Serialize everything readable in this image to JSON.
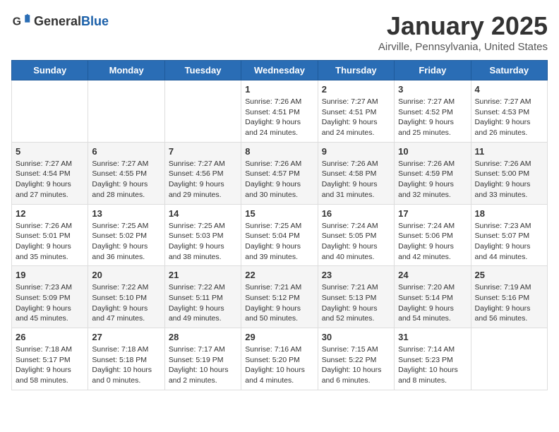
{
  "header": {
    "logo_general": "General",
    "logo_blue": "Blue",
    "month": "January 2025",
    "location": "Airville, Pennsylvania, United States"
  },
  "weekdays": [
    "Sunday",
    "Monday",
    "Tuesday",
    "Wednesday",
    "Thursday",
    "Friday",
    "Saturday"
  ],
  "weeks": [
    [
      {
        "day": "",
        "text": ""
      },
      {
        "day": "",
        "text": ""
      },
      {
        "day": "",
        "text": ""
      },
      {
        "day": "1",
        "text": "Sunrise: 7:26 AM\nSunset: 4:51 PM\nDaylight: 9 hours\nand 24 minutes."
      },
      {
        "day": "2",
        "text": "Sunrise: 7:27 AM\nSunset: 4:51 PM\nDaylight: 9 hours\nand 24 minutes."
      },
      {
        "day": "3",
        "text": "Sunrise: 7:27 AM\nSunset: 4:52 PM\nDaylight: 9 hours\nand 25 minutes."
      },
      {
        "day": "4",
        "text": "Sunrise: 7:27 AM\nSunset: 4:53 PM\nDaylight: 9 hours\nand 26 minutes."
      }
    ],
    [
      {
        "day": "5",
        "text": "Sunrise: 7:27 AM\nSunset: 4:54 PM\nDaylight: 9 hours\nand 27 minutes."
      },
      {
        "day": "6",
        "text": "Sunrise: 7:27 AM\nSunset: 4:55 PM\nDaylight: 9 hours\nand 28 minutes."
      },
      {
        "day": "7",
        "text": "Sunrise: 7:27 AM\nSunset: 4:56 PM\nDaylight: 9 hours\nand 29 minutes."
      },
      {
        "day": "8",
        "text": "Sunrise: 7:26 AM\nSunset: 4:57 PM\nDaylight: 9 hours\nand 30 minutes."
      },
      {
        "day": "9",
        "text": "Sunrise: 7:26 AM\nSunset: 4:58 PM\nDaylight: 9 hours\nand 31 minutes."
      },
      {
        "day": "10",
        "text": "Sunrise: 7:26 AM\nSunset: 4:59 PM\nDaylight: 9 hours\nand 32 minutes."
      },
      {
        "day": "11",
        "text": "Sunrise: 7:26 AM\nSunset: 5:00 PM\nDaylight: 9 hours\nand 33 minutes."
      }
    ],
    [
      {
        "day": "12",
        "text": "Sunrise: 7:26 AM\nSunset: 5:01 PM\nDaylight: 9 hours\nand 35 minutes."
      },
      {
        "day": "13",
        "text": "Sunrise: 7:25 AM\nSunset: 5:02 PM\nDaylight: 9 hours\nand 36 minutes."
      },
      {
        "day": "14",
        "text": "Sunrise: 7:25 AM\nSunset: 5:03 PM\nDaylight: 9 hours\nand 38 minutes."
      },
      {
        "day": "15",
        "text": "Sunrise: 7:25 AM\nSunset: 5:04 PM\nDaylight: 9 hours\nand 39 minutes."
      },
      {
        "day": "16",
        "text": "Sunrise: 7:24 AM\nSunset: 5:05 PM\nDaylight: 9 hours\nand 40 minutes."
      },
      {
        "day": "17",
        "text": "Sunrise: 7:24 AM\nSunset: 5:06 PM\nDaylight: 9 hours\nand 42 minutes."
      },
      {
        "day": "18",
        "text": "Sunrise: 7:23 AM\nSunset: 5:07 PM\nDaylight: 9 hours\nand 44 minutes."
      }
    ],
    [
      {
        "day": "19",
        "text": "Sunrise: 7:23 AM\nSunset: 5:09 PM\nDaylight: 9 hours\nand 45 minutes."
      },
      {
        "day": "20",
        "text": "Sunrise: 7:22 AM\nSunset: 5:10 PM\nDaylight: 9 hours\nand 47 minutes."
      },
      {
        "day": "21",
        "text": "Sunrise: 7:22 AM\nSunset: 5:11 PM\nDaylight: 9 hours\nand 49 minutes."
      },
      {
        "day": "22",
        "text": "Sunrise: 7:21 AM\nSunset: 5:12 PM\nDaylight: 9 hours\nand 50 minutes."
      },
      {
        "day": "23",
        "text": "Sunrise: 7:21 AM\nSunset: 5:13 PM\nDaylight: 9 hours\nand 52 minutes."
      },
      {
        "day": "24",
        "text": "Sunrise: 7:20 AM\nSunset: 5:14 PM\nDaylight: 9 hours\nand 54 minutes."
      },
      {
        "day": "25",
        "text": "Sunrise: 7:19 AM\nSunset: 5:16 PM\nDaylight: 9 hours\nand 56 minutes."
      }
    ],
    [
      {
        "day": "26",
        "text": "Sunrise: 7:18 AM\nSunset: 5:17 PM\nDaylight: 9 hours\nand 58 minutes."
      },
      {
        "day": "27",
        "text": "Sunrise: 7:18 AM\nSunset: 5:18 PM\nDaylight: 10 hours\nand 0 minutes."
      },
      {
        "day": "28",
        "text": "Sunrise: 7:17 AM\nSunset: 5:19 PM\nDaylight: 10 hours\nand 2 minutes."
      },
      {
        "day": "29",
        "text": "Sunrise: 7:16 AM\nSunset: 5:20 PM\nDaylight: 10 hours\nand 4 minutes."
      },
      {
        "day": "30",
        "text": "Sunrise: 7:15 AM\nSunset: 5:22 PM\nDaylight: 10 hours\nand 6 minutes."
      },
      {
        "day": "31",
        "text": "Sunrise: 7:14 AM\nSunset: 5:23 PM\nDaylight: 10 hours\nand 8 minutes."
      },
      {
        "day": "",
        "text": ""
      }
    ]
  ]
}
